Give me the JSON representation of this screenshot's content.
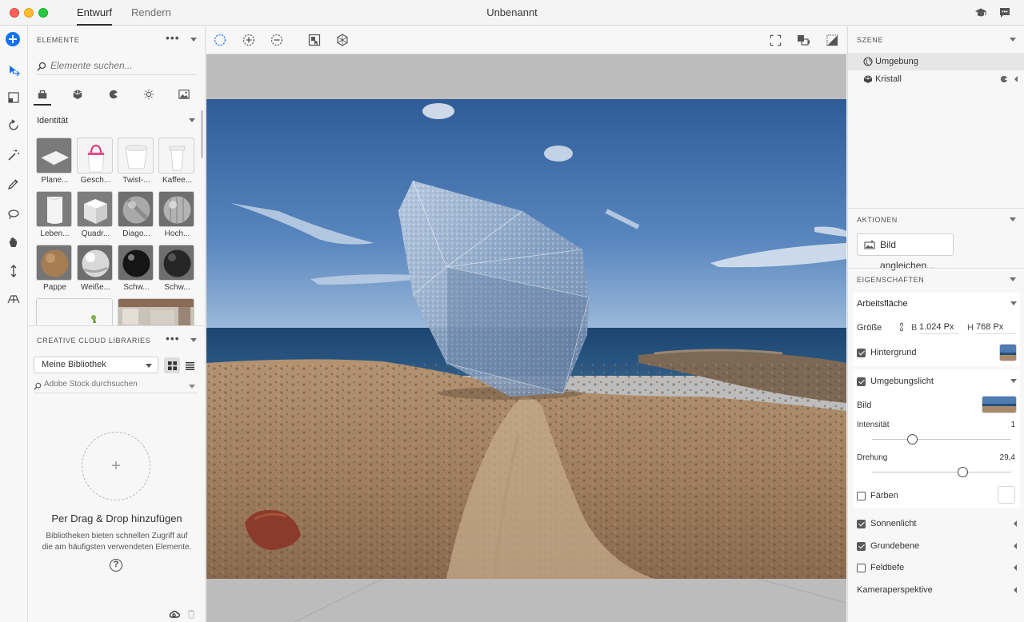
{
  "window": {
    "title": "Unbenannt",
    "tabs": [
      {
        "label": "Entwurf"
      },
      {
        "label": "Rendern"
      }
    ]
  },
  "elements_panel": {
    "title": "ELEMENTE",
    "search_placeholder": "Elemente suchen...",
    "section": "Identität",
    "items": [
      {
        "label": "Plane..."
      },
      {
        "label": "Gesch..."
      },
      {
        "label": "Twist-..."
      },
      {
        "label": "Kaffee..."
      },
      {
        "label": "Leben..."
      },
      {
        "label": "Quadr..."
      },
      {
        "label": "Diago..."
      },
      {
        "label": "Hoch..."
      },
      {
        "label": "Pappe"
      },
      {
        "label": "Weiße..."
      },
      {
        "label": "Schw..."
      },
      {
        "label": "Schw..."
      }
    ]
  },
  "libraries_panel": {
    "title": "CREATIVE CLOUD LIBRARIES",
    "library_select": "Meine Bibliothek",
    "stock_placeholder": "Adobe Stock durchsuchen",
    "drop_title": "Per Drag & Drop hinzufügen",
    "drop_description": "Bibliotheken bieten schnellen Zugriff auf die am häufigsten verwendeten Elemente.",
    "help": "?"
  },
  "scene_panel": {
    "title": "SZENE",
    "items": [
      {
        "label": "Umgebung"
      },
      {
        "label": "Kristall"
      }
    ]
  },
  "actions_panel": {
    "title": "AKTIONEN",
    "match_image_button": "Bild angleichen..."
  },
  "properties_panel": {
    "title": "EIGENSCHAFTEN",
    "artboard": {
      "title": "Arbeitsfläche",
      "size_label": "Größe",
      "width_label": "B",
      "width_value": "1.024 Px",
      "height_label": "H",
      "height_value": "768 Px",
      "background_label": "Hintergrund",
      "background_checked": true
    },
    "environment_light": {
      "label": "Umgebungslicht",
      "checked": true,
      "image_label": "Bild",
      "intensity_label": "Intensität",
      "intensity_value": "1",
      "intensity_fraction": 0.29,
      "rotation_label": "Drehung",
      "rotation_value": "29,4",
      "rotation_fraction": 0.65,
      "tint_label": "Färben",
      "tint_checked": false
    },
    "sunlight": {
      "label": "Sonnenlicht",
      "checked": true
    },
    "ground_plane": {
      "label": "Grundebene",
      "checked": true
    },
    "depth_of_field": {
      "label": "Feldtiefe",
      "checked": false
    },
    "camera_perspective": {
      "label": "Kameraperspektive"
    }
  },
  "colors": {
    "accent": "#1473e6",
    "sky": "#3f6ea8",
    "sea": "#1f4a78",
    "ground": "#a88a6b"
  }
}
